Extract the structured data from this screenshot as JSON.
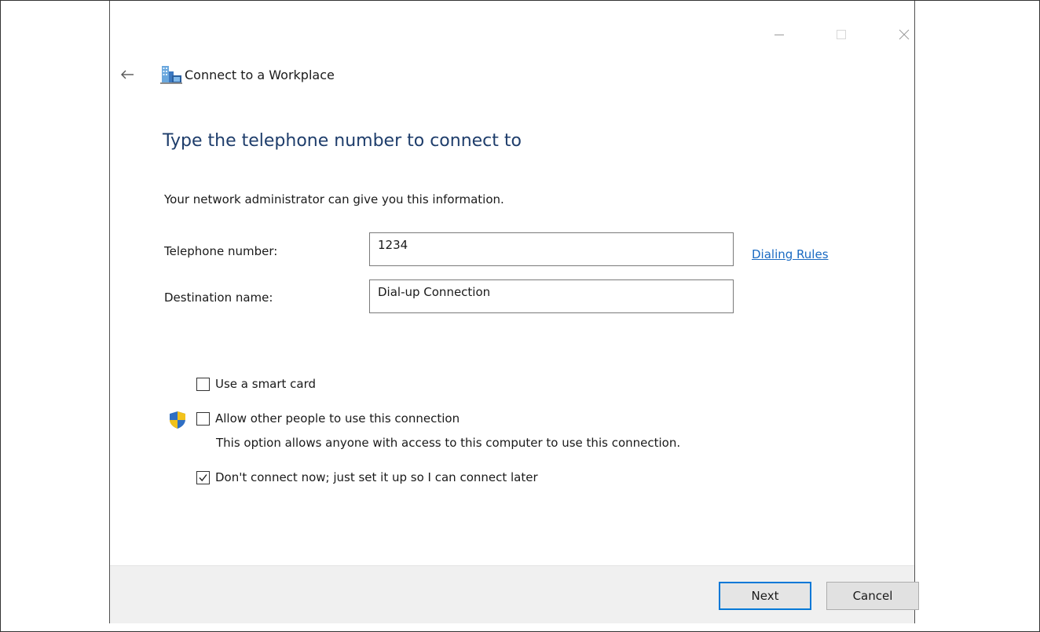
{
  "window": {
    "title": "Connect to a Workplace",
    "controls": [
      "minimize-icon",
      "maximize-icon",
      "close-icon"
    ]
  },
  "navigation": {
    "back_icon": "back-arrow-icon",
    "app_icon": "workplace-network-icon"
  },
  "page": {
    "heading": "Type the telephone number to connect to",
    "info": "Your network administrator can give you this information."
  },
  "form": {
    "telephone": {
      "label": "Telephone number:",
      "value": "1234"
    },
    "destination": {
      "label": "Destination name:",
      "value": "Dial-up Connection"
    },
    "dialing_rules_link": "Dialing Rules"
  },
  "options": {
    "smart_card": {
      "label": "Use a smart card",
      "checked": false
    },
    "allow_others": {
      "label": "Allow other people to use this connection",
      "description": "This option allows anyone with access to this computer to use this connection.",
      "checked": false,
      "icon": "uac-shield-icon"
    },
    "dont_connect": {
      "label": "Don't connect now; just set it up so I can connect later",
      "checked": true
    }
  },
  "footer": {
    "next_label": "Next",
    "cancel_label": "Cancel"
  },
  "colors": {
    "heading": "#1e3d6b",
    "link": "#1a6ac2",
    "default_button_border": "#0078d7",
    "footer_background": "#f0f0f0"
  }
}
